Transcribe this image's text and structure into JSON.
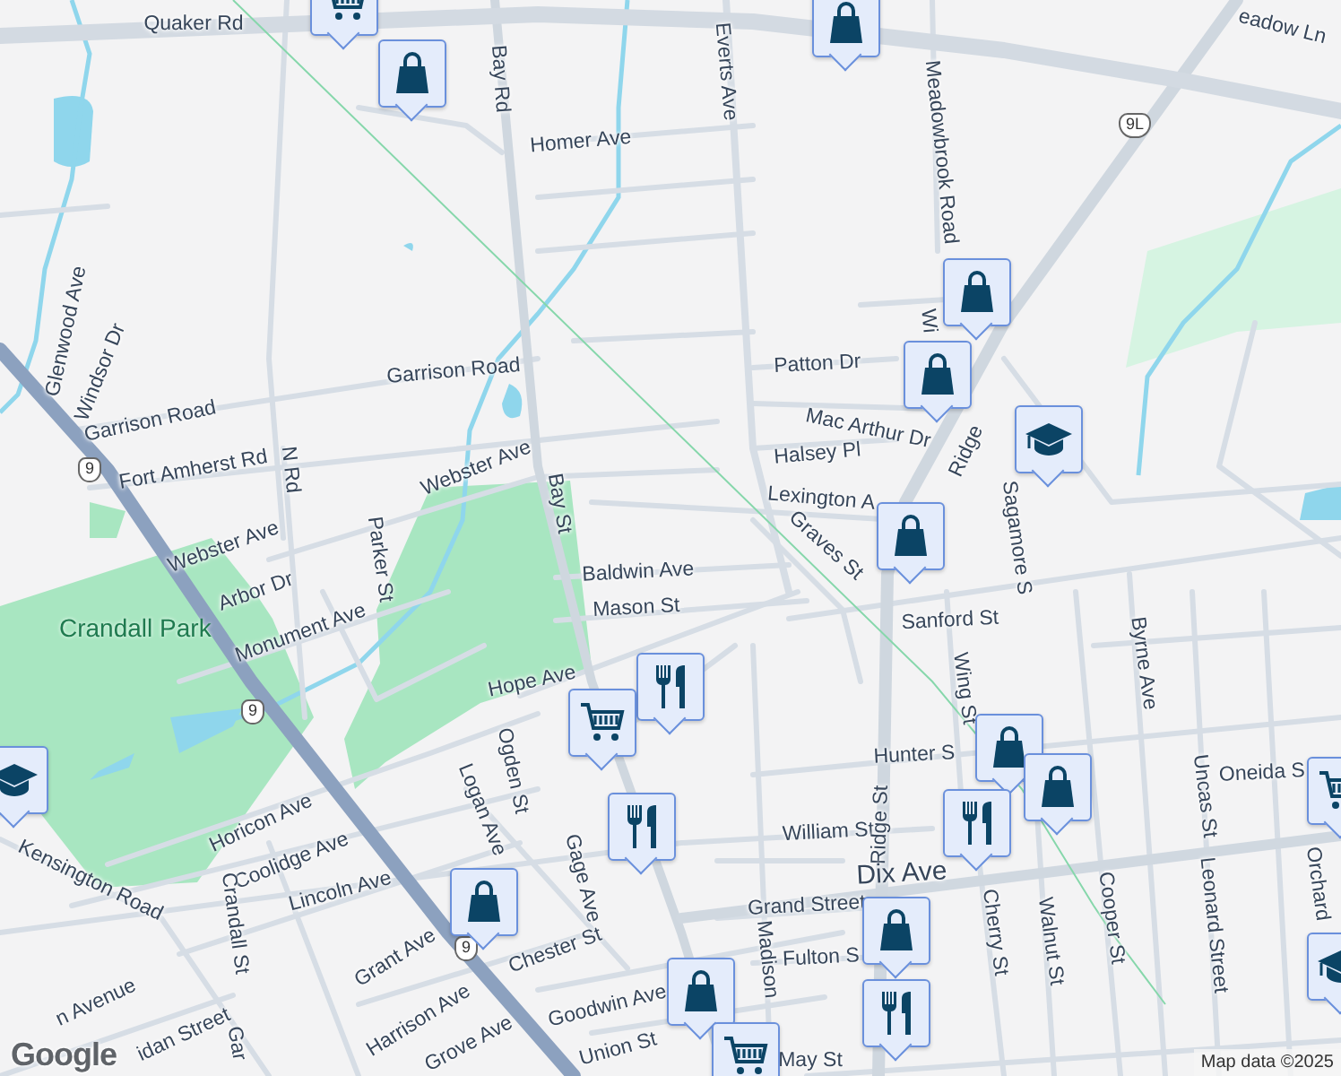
{
  "map": {
    "street_labels": [
      "Quaker Rd",
      "Bay Rd",
      "Homer Ave",
      "Everts Ave",
      "Meadowbrook Road",
      "Glenwood Ave",
      "Windsor Dr",
      "Garrison Road",
      "Garrison Road",
      "Fort Amherst Rd",
      "N Rd",
      "Webster Ave",
      "Bay St",
      "Parker St",
      "Webster Ave",
      "Arbor Dr",
      "Monument Ave",
      "Baldwin Ave",
      "Mason St",
      "Hope Ave",
      "Ogden St",
      "Logan Ave",
      "Horicon Ave",
      "Coolidge Ave",
      "Kensington Road",
      "Lincoln Ave",
      "Crandall St",
      "Gage Ave",
      "Grant Ave",
      "Chester St",
      "Harrison Ave",
      "Goodwin Ave",
      "Union St",
      "Grove Ave",
      "n Avenue",
      "idan Street",
      "Gar",
      "Patton Dr",
      "Mac Arthur Dr",
      "Halsey Pl",
      "Lexington A",
      "Graves St",
      "Wi",
      "Ridge",
      "Sagamore S",
      "Sanford St",
      "Wing St",
      "Byrne Ave",
      "Hunter S",
      "Oneida S",
      "William St",
      "Ridge St",
      "Dix Ave",
      "Grand Street",
      "Cherry St",
      "Walnut St",
      "Cooper St",
      "Leonard Street",
      "Uncas St",
      "Orchard",
      "Fulton S",
      "Madison",
      "May St",
      "eadow Ln"
    ],
    "park_labels": [
      "Crandall Park"
    ],
    "route_shields": [
      "9",
      "9",
      "9",
      "9L"
    ],
    "pins": [
      {
        "kind": "grocery"
      },
      {
        "kind": "shopping"
      },
      {
        "kind": "shopping"
      },
      {
        "kind": "shopping"
      },
      {
        "kind": "shopping"
      },
      {
        "kind": "school"
      },
      {
        "kind": "shopping"
      },
      {
        "kind": "restaurant"
      },
      {
        "kind": "grocery"
      },
      {
        "kind": "restaurant"
      },
      {
        "kind": "shopping"
      },
      {
        "kind": "shopping"
      },
      {
        "kind": "shopping"
      },
      {
        "kind": "restaurant"
      },
      {
        "kind": "school"
      },
      {
        "kind": "shopping"
      },
      {
        "kind": "restaurant"
      },
      {
        "kind": "shopping"
      },
      {
        "kind": "grocery"
      },
      {
        "kind": "grocery"
      },
      {
        "kind": "school"
      }
    ]
  },
  "logo": "Google",
  "attribution": "Map data ©2025"
}
